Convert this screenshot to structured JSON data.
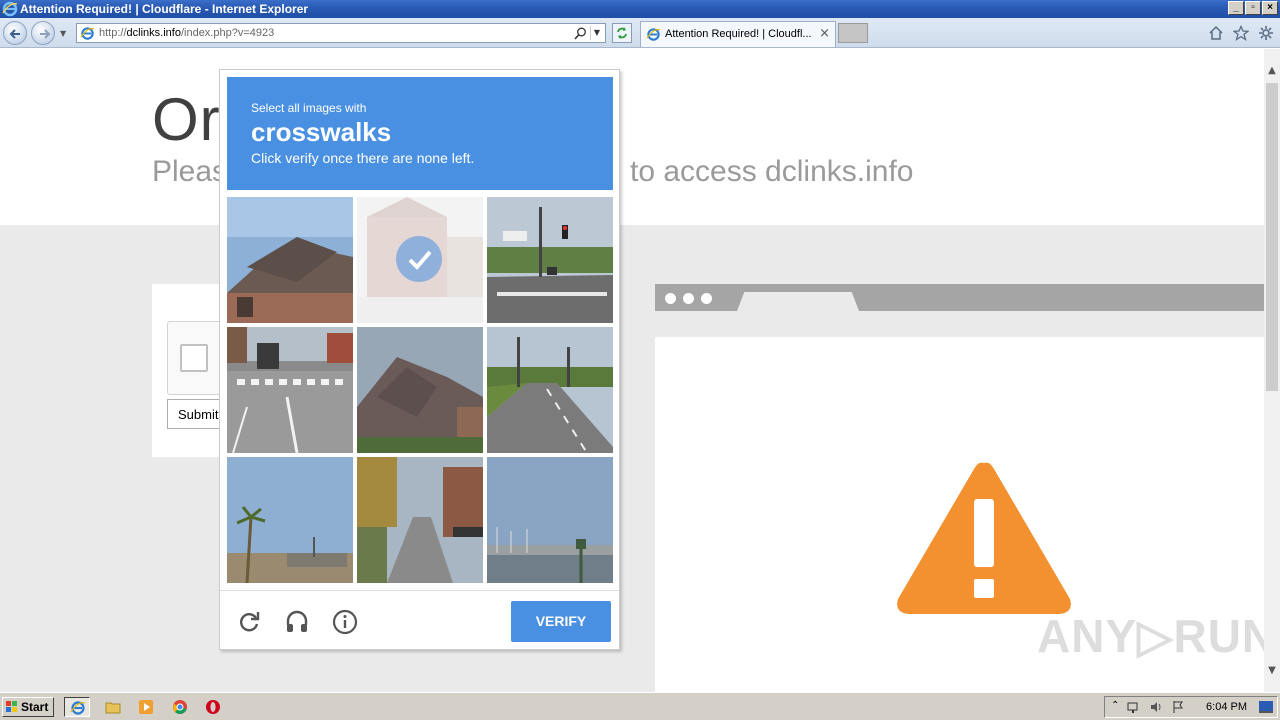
{
  "window": {
    "title": "Attention Required! | Cloudflare - Internet Explorer",
    "min": "_",
    "max": "▫",
    "close": "×"
  },
  "browser": {
    "url_prefix": "http://",
    "url_host": "dclinks.info",
    "url_path": "/index.php?v=4923",
    "tab_title": "Attention Required! | Cloudfl...",
    "tab_close": "×"
  },
  "page": {
    "headline": "Or",
    "subline_left": "Pleas",
    "subline_right": "to access dclinks.info",
    "submit_label": "Submit"
  },
  "captcha": {
    "instruction": "Select all images with",
    "target": "crosswalks",
    "hint": "Click verify once there are none left.",
    "verify_label": "VERIFY",
    "tiles": [
      {
        "name": "tile-house-roof",
        "selected": false
      },
      {
        "name": "tile-brick-building",
        "selected": true
      },
      {
        "name": "tile-intersection-traffic-light",
        "selected": false
      },
      {
        "name": "tile-crosswalk-street-bus",
        "selected": false
      },
      {
        "name": "tile-shingled-roof",
        "selected": false
      },
      {
        "name": "tile-road-median",
        "selected": false
      },
      {
        "name": "tile-palm-trees",
        "selected": false
      },
      {
        "name": "tile-residential-street",
        "selected": false
      },
      {
        "name": "tile-harbor-lamppost",
        "selected": false
      }
    ]
  },
  "watermark": "ANY▷RUN",
  "taskbar": {
    "start_label": "Start",
    "clock": "6:04 PM"
  },
  "colors": {
    "captcha_blue": "#4a90e2",
    "warning_orange": "#f39130",
    "titlebar_blue": "#2a5bb5"
  }
}
